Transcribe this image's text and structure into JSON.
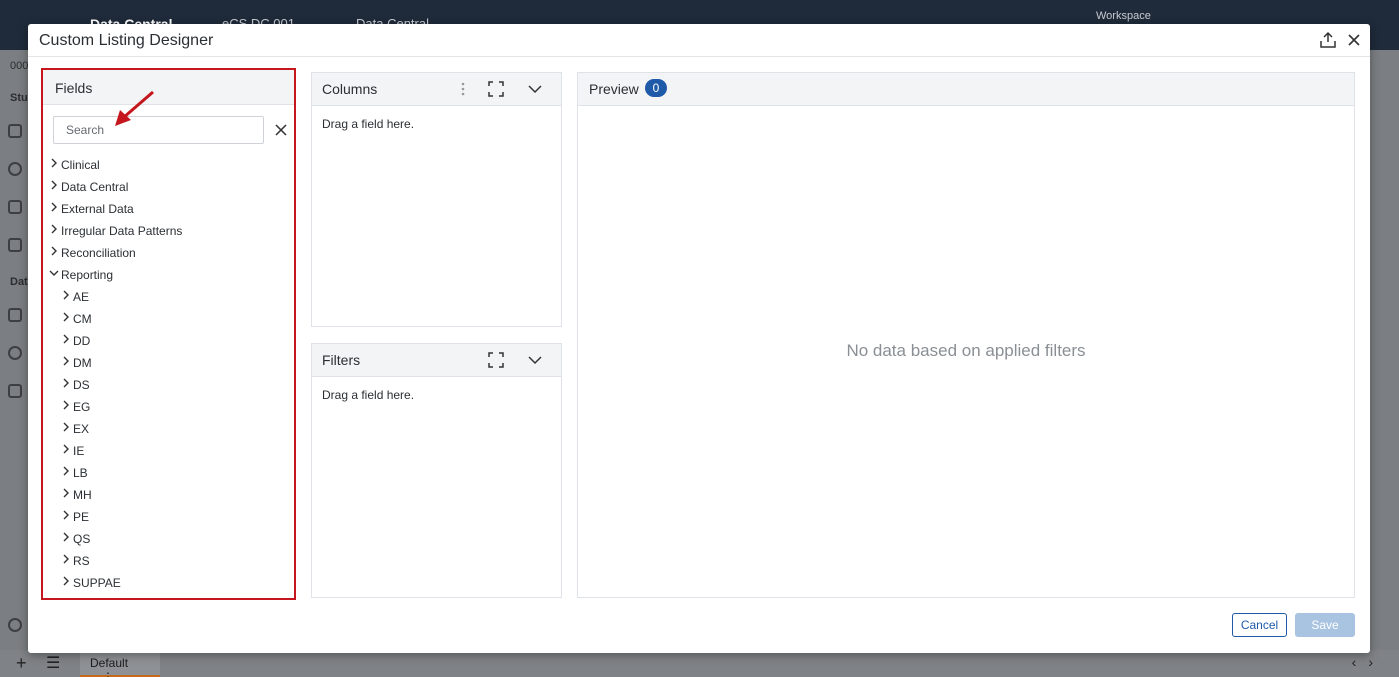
{
  "background": {
    "app_title": "Data Central",
    "study": "eCS DC 001",
    "module": "Data Central",
    "workspace": "Workspace",
    "left_labels": [
      "000",
      "Stu",
      "Dat"
    ],
    "bottom_tab": "Default"
  },
  "modal": {
    "title": "Custom Listing Designer"
  },
  "fields": {
    "title": "Fields",
    "search_placeholder": "Search",
    "tree": [
      {
        "label": "Clinical",
        "expanded": false,
        "level": 0
      },
      {
        "label": "Data Central",
        "expanded": false,
        "level": 0
      },
      {
        "label": "External Data",
        "expanded": false,
        "level": 0
      },
      {
        "label": "Irregular Data Patterns",
        "expanded": false,
        "level": 0
      },
      {
        "label": "Reconciliation",
        "expanded": false,
        "level": 0
      },
      {
        "label": "Reporting",
        "expanded": true,
        "level": 0
      },
      {
        "label": "AE",
        "expanded": false,
        "level": 1
      },
      {
        "label": "CM",
        "expanded": false,
        "level": 1
      },
      {
        "label": "DD",
        "expanded": false,
        "level": 1
      },
      {
        "label": "DM",
        "expanded": false,
        "level": 1
      },
      {
        "label": "DS",
        "expanded": false,
        "level": 1
      },
      {
        "label": "EG",
        "expanded": false,
        "level": 1
      },
      {
        "label": "EX",
        "expanded": false,
        "level": 1
      },
      {
        "label": "IE",
        "expanded": false,
        "level": 1
      },
      {
        "label": "LB",
        "expanded": false,
        "level": 1
      },
      {
        "label": "MH",
        "expanded": false,
        "level": 1
      },
      {
        "label": "PE",
        "expanded": false,
        "level": 1
      },
      {
        "label": "QS",
        "expanded": false,
        "level": 1
      },
      {
        "label": "RS",
        "expanded": false,
        "level": 1
      },
      {
        "label": "SUPPAE",
        "expanded": false,
        "level": 1
      }
    ]
  },
  "columns": {
    "title": "Columns",
    "drop_hint": "Drag a field here."
  },
  "filters": {
    "title": "Filters",
    "drop_hint": "Drag a field here."
  },
  "preview": {
    "title": "Preview",
    "count": "0",
    "empty_message": "No data based on applied filters"
  },
  "footer": {
    "cancel_label": "Cancel",
    "save_label": "Save"
  },
  "colors": {
    "highlight_border": "#c4161c",
    "accent": "#1e5aa8",
    "save_disabled": "#a9c4e0"
  }
}
